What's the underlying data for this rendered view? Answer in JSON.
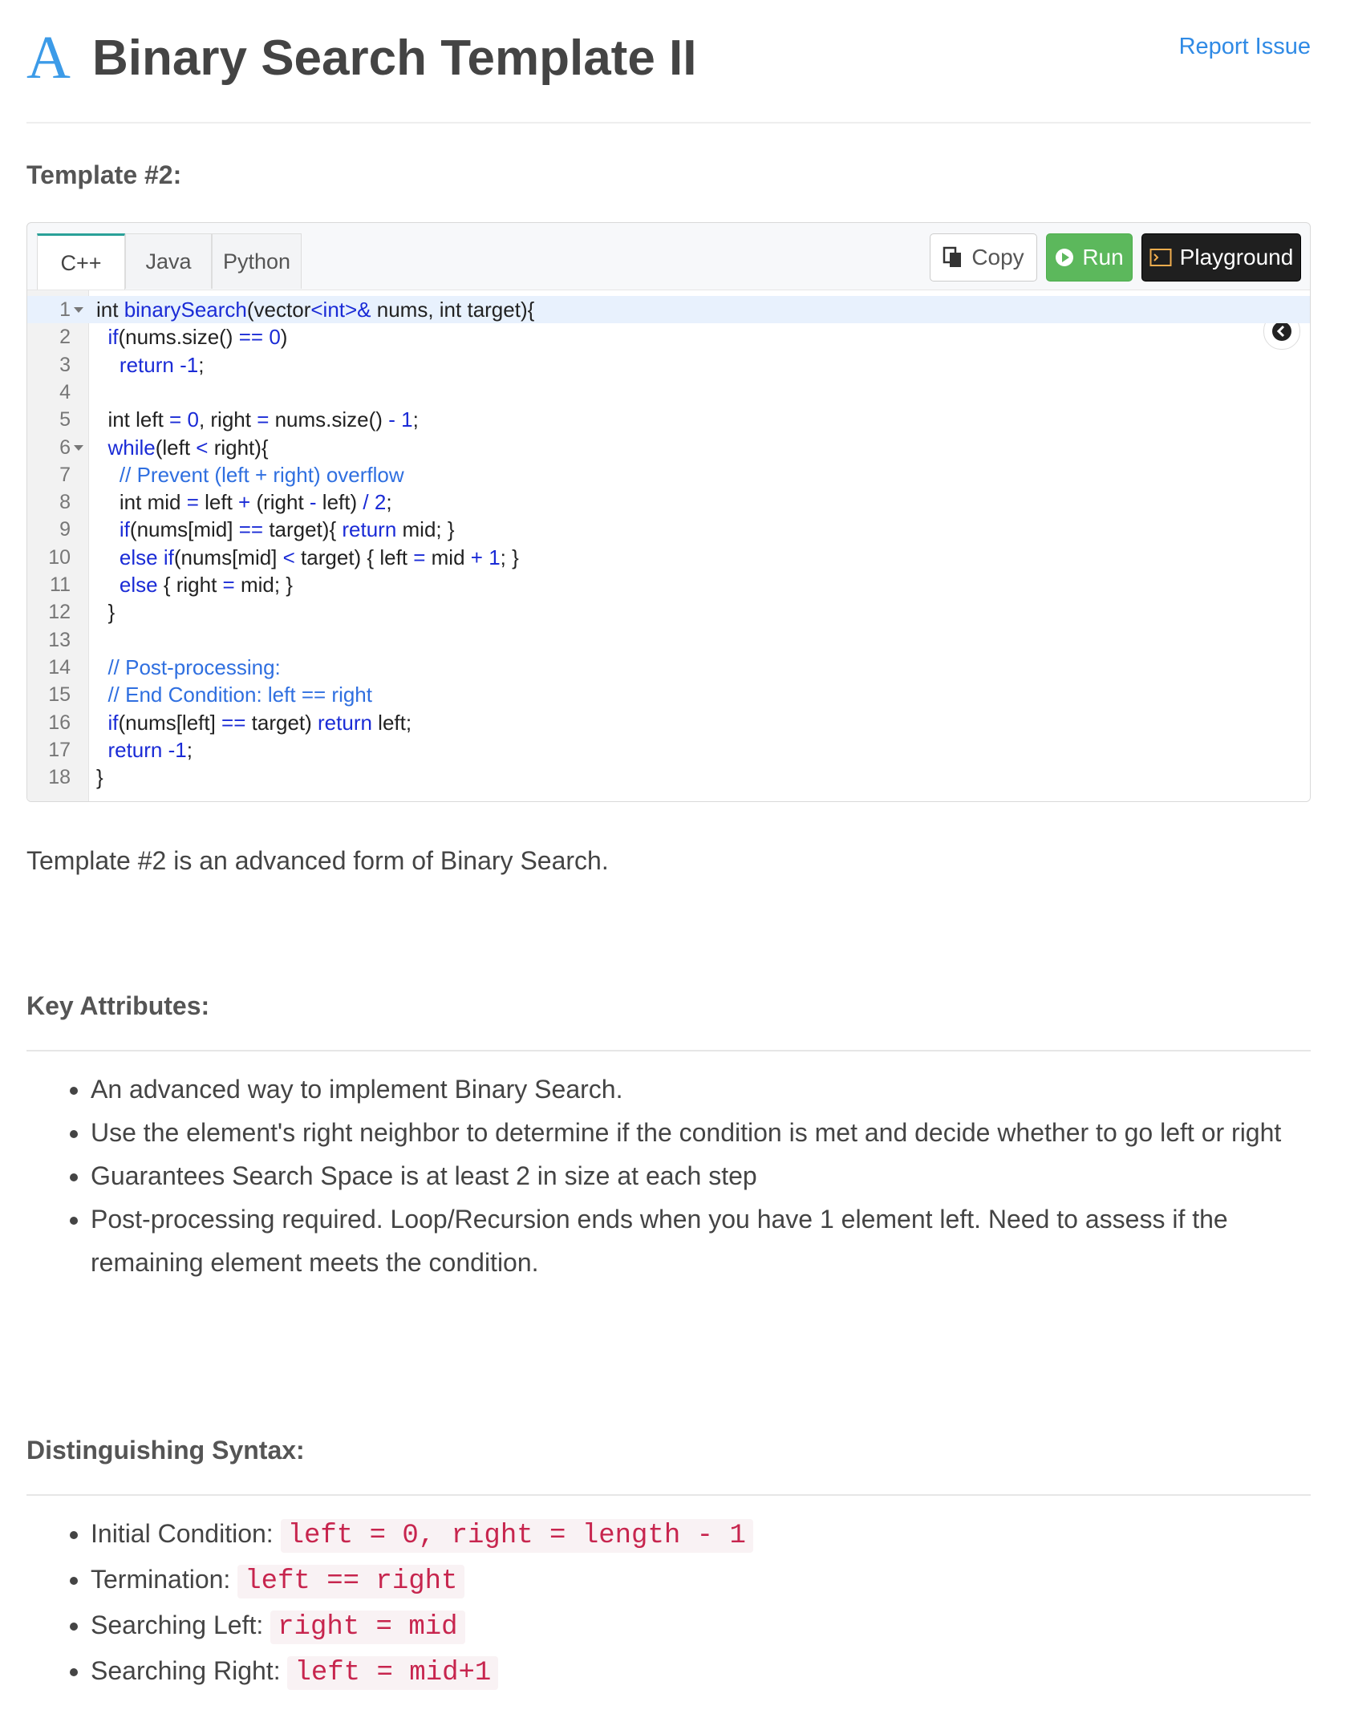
{
  "header": {
    "logo_letter": "A",
    "title": "Binary Search Template II",
    "report_link": "Report Issue"
  },
  "template_heading": "Template #2:",
  "code_panel": {
    "tabs": [
      {
        "label": "C++",
        "active": true
      },
      {
        "label": "Java",
        "active": false
      },
      {
        "label": "Python",
        "active": false
      }
    ],
    "copy_label": "Copy",
    "run_label": "Run",
    "playground_label": "Playground",
    "lines": [
      {
        "n": "1",
        "fold": true,
        "tokens": [
          [
            "int ",
            "p"
          ],
          [
            "binarySearch",
            "f"
          ],
          [
            "(vector",
            "p"
          ],
          [
            "<int>&",
            "k"
          ],
          [
            " nums, int target){",
            "p"
          ]
        ]
      },
      {
        "n": "2",
        "fold": false,
        "tokens": [
          [
            "  ",
            "p"
          ],
          [
            "if",
            "k"
          ],
          [
            "(nums.size() ",
            "p"
          ],
          [
            "==",
            "o"
          ],
          [
            " ",
            "p"
          ],
          [
            "0",
            "k"
          ],
          [
            ")",
            "p"
          ]
        ]
      },
      {
        "n": "3",
        "fold": false,
        "tokens": [
          [
            "    ",
            "p"
          ],
          [
            "return",
            "k"
          ],
          [
            " ",
            "p"
          ],
          [
            "-1",
            "k"
          ],
          [
            ";",
            "p"
          ]
        ]
      },
      {
        "n": "4",
        "fold": false,
        "tokens": []
      },
      {
        "n": "5",
        "fold": false,
        "tokens": [
          [
            "  int left ",
            "p"
          ],
          [
            "=",
            "o"
          ],
          [
            " ",
            "p"
          ],
          [
            "0",
            "k"
          ],
          [
            ", right ",
            "p"
          ],
          [
            "=",
            "o"
          ],
          [
            " nums.size() ",
            "p"
          ],
          [
            "-",
            "o"
          ],
          [
            " ",
            "p"
          ],
          [
            "1",
            "k"
          ],
          [
            ";",
            "p"
          ]
        ]
      },
      {
        "n": "6",
        "fold": true,
        "tokens": [
          [
            "  ",
            "p"
          ],
          [
            "while",
            "k"
          ],
          [
            "(left ",
            "p"
          ],
          [
            "<",
            "o"
          ],
          [
            " right){",
            "p"
          ]
        ]
      },
      {
        "n": "7",
        "fold": false,
        "tokens": [
          [
            "    ",
            "p"
          ],
          [
            "// Prevent (left + right) overflow",
            "c"
          ]
        ]
      },
      {
        "n": "8",
        "fold": false,
        "tokens": [
          [
            "    int mid ",
            "p"
          ],
          [
            "=",
            "o"
          ],
          [
            " left ",
            "p"
          ],
          [
            "+",
            "o"
          ],
          [
            " (right ",
            "p"
          ],
          [
            "-",
            "o"
          ],
          [
            " left) ",
            "p"
          ],
          [
            "/",
            "o"
          ],
          [
            " ",
            "p"
          ],
          [
            "2",
            "k"
          ],
          [
            ";",
            "p"
          ]
        ]
      },
      {
        "n": "9",
        "fold": false,
        "tokens": [
          [
            "    ",
            "p"
          ],
          [
            "if",
            "k"
          ],
          [
            "(nums[mid] ",
            "p"
          ],
          [
            "==",
            "o"
          ],
          [
            " target){ ",
            "p"
          ],
          [
            "return",
            "k"
          ],
          [
            " mid; }",
            "p"
          ]
        ]
      },
      {
        "n": "10",
        "fold": false,
        "tokens": [
          [
            "    ",
            "p"
          ],
          [
            "else if",
            "k"
          ],
          [
            "(nums[mid] ",
            "p"
          ],
          [
            "<",
            "o"
          ],
          [
            " target) { left ",
            "p"
          ],
          [
            "=",
            "o"
          ],
          [
            " mid ",
            "p"
          ],
          [
            "+",
            "o"
          ],
          [
            " ",
            "p"
          ],
          [
            "1",
            "k"
          ],
          [
            "; }",
            "p"
          ]
        ]
      },
      {
        "n": "11",
        "fold": false,
        "tokens": [
          [
            "    ",
            "p"
          ],
          [
            "else",
            "k"
          ],
          [
            " { right ",
            "p"
          ],
          [
            "=",
            "o"
          ],
          [
            " mid; }",
            "p"
          ]
        ]
      },
      {
        "n": "12",
        "fold": false,
        "tokens": [
          [
            "  }",
            "p"
          ]
        ]
      },
      {
        "n": "13",
        "fold": false,
        "tokens": []
      },
      {
        "n": "14",
        "fold": false,
        "tokens": [
          [
            "  ",
            "p"
          ],
          [
            "// Post-processing:",
            "c"
          ]
        ]
      },
      {
        "n": "15",
        "fold": false,
        "tokens": [
          [
            "  ",
            "p"
          ],
          [
            "// End Condition: left == right",
            "c"
          ]
        ]
      },
      {
        "n": "16",
        "fold": false,
        "tokens": [
          [
            "  ",
            "p"
          ],
          [
            "if",
            "k"
          ],
          [
            "(nums[left] ",
            "p"
          ],
          [
            "==",
            "o"
          ],
          [
            " target) ",
            "p"
          ],
          [
            "return",
            "k"
          ],
          [
            " left;",
            "p"
          ]
        ]
      },
      {
        "n": "17",
        "fold": false,
        "tokens": [
          [
            "  ",
            "p"
          ],
          [
            "return",
            "k"
          ],
          [
            " ",
            "p"
          ],
          [
            "-1",
            "k"
          ],
          [
            ";",
            "p"
          ]
        ]
      },
      {
        "n": "18",
        "fold": false,
        "tokens": [
          [
            "}",
            "p"
          ]
        ]
      }
    ]
  },
  "intro": "Template #2 is an advanced form of Binary Search.",
  "key_attributes": {
    "heading": "Key Attributes:",
    "items": [
      "An advanced way to implement Binary Search.",
      "Use the element's right neighbor to determine if the condition is met and decide whether to go left or right",
      "Guarantees Search Space is at least 2 in size at each step",
      "Post-processing required. Loop/Recursion ends when you have 1 element left. Need to assess if the remaining element meets the condition."
    ]
  },
  "syntax": {
    "heading": "Distinguishing Syntax:",
    "items": [
      {
        "label": "Initial Condition: ",
        "code": "left = 0, right = length - 1"
      },
      {
        "label": "Termination: ",
        "code": "left == right"
      },
      {
        "label": "Searching Left: ",
        "code": "right = mid"
      },
      {
        "label": "Searching Right: ",
        "code": "left = mid+1"
      }
    ]
  },
  "colors": {
    "plain": "#222222",
    "keyword": "#1a2bd6",
    "operator": "#1a2bd6",
    "comment": "#2f6fe0",
    "accent": "#3c9be8"
  }
}
